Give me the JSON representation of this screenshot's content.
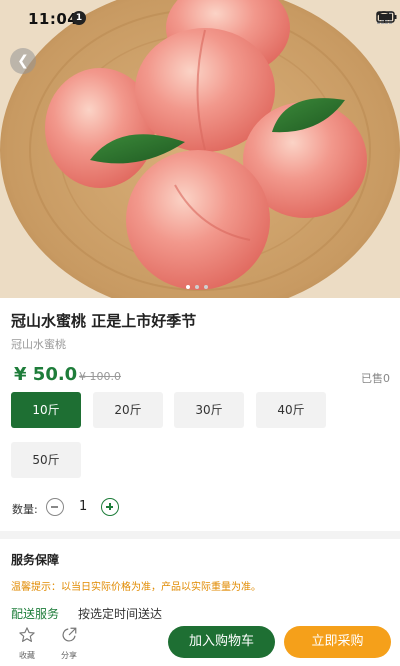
{
  "status_bar": {
    "time": "11:04",
    "notification_count": "1",
    "icons": [
      "wifi-icon",
      "signal-icon",
      "signal-icon",
      "battery-icon"
    ]
  },
  "hero": {
    "image": "peaches-in-wooden-bowl",
    "slide_count": 3,
    "active_slide": 1
  },
  "product": {
    "title": "冠山水蜜桃 正是上市好季节",
    "subtitle": "冠山水蜜桃",
    "price": "¥ 50.0",
    "old_price": "¥ 100.0",
    "sold": "已售0"
  },
  "specs": {
    "options": [
      "10斤",
      "20斤",
      "30斤",
      "40斤",
      "50斤"
    ],
    "selected_index": 0
  },
  "quantity": {
    "label": "数量:",
    "value": "1"
  },
  "service": {
    "title": "服务保障",
    "tip": "温馨提示：以当日实际价格为准，产品以实际重量为准。",
    "delivery_label": "配送服务",
    "delivery_value": "按选定时间送达"
  },
  "bottom_bar": {
    "favorite_label": "收藏",
    "share_label": "分享",
    "add_to_cart": "加入购物车",
    "buy_now": "立即采购"
  },
  "colors": {
    "primary_green": "#1e6f33",
    "accent_orange": "#f5a01a",
    "tip_orange": "#e08a00"
  }
}
